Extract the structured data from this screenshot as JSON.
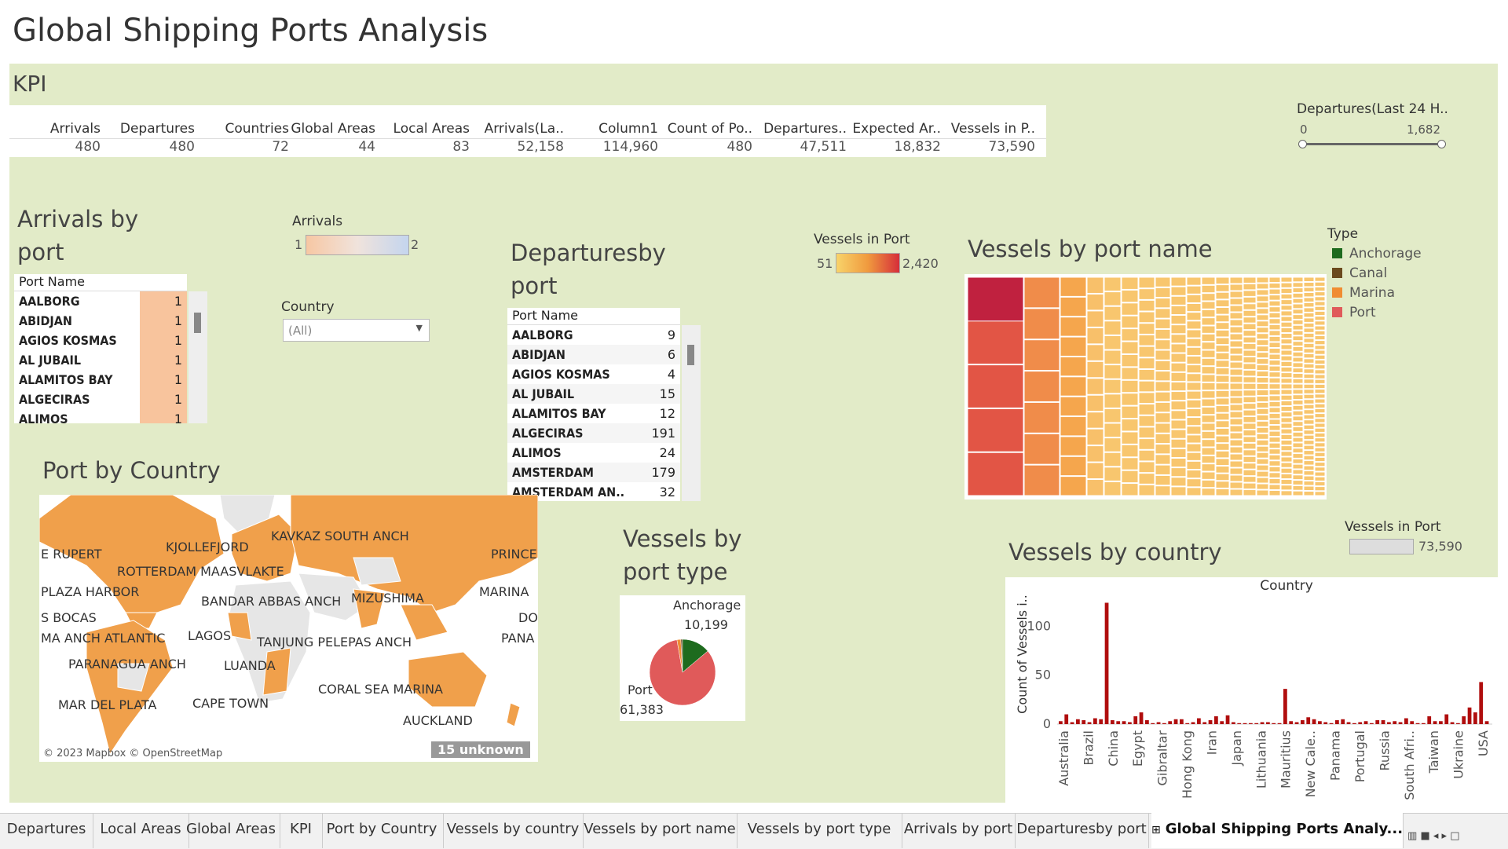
{
  "header": {
    "title": "Global Shipping Ports Analysis"
  },
  "kpi": {
    "title": "KPI",
    "columns": [
      {
        "label": "Arrivals",
        "value": "480"
      },
      {
        "label": "Departures",
        "value": "480"
      },
      {
        "label": "Countries",
        "value": "72"
      },
      {
        "label": "Global Areas",
        "value": "44"
      },
      {
        "label": "Local Areas",
        "value": "83"
      },
      {
        "label": "Arrivals(La..",
        "value": "52,158"
      },
      {
        "label": "Column1",
        "value": "114,960"
      },
      {
        "label": "Count of Po..",
        "value": "480"
      },
      {
        "label": "Departures..",
        "value": "47,511"
      },
      {
        "label": "Expected Ar..",
        "value": "18,832"
      },
      {
        "label": "Vessels in P..",
        "value": "73,590"
      }
    ]
  },
  "departures_filter": {
    "title": "Departures(Last 24 H..",
    "min": "0",
    "max": "1,682"
  },
  "arrivals_by_port": {
    "title_line1": "Arrivals by",
    "title_line2": "port",
    "column_header": "Port Name",
    "rows": [
      {
        "name": "AALBORG",
        "value": "1"
      },
      {
        "name": "ABIDJAN",
        "value": "1"
      },
      {
        "name": "AGIOS KOSMAS",
        "value": "1"
      },
      {
        "name": "AL JUBAIL",
        "value": "1"
      },
      {
        "name": "ALAMITOS BAY",
        "value": "1"
      },
      {
        "name": "ALGECIRAS",
        "value": "1"
      },
      {
        "name": "ALIMOS",
        "value": "1"
      }
    ],
    "legend_title": "Arrivals",
    "legend_min": "1",
    "legend_max": "2"
  },
  "country_filter": {
    "label": "Country",
    "selected": "(All)"
  },
  "departures_by_port": {
    "title_line1": "Departuresby",
    "title_line2": "port",
    "column_header": "Port Name",
    "rows": [
      {
        "name": "AALBORG",
        "value": "9"
      },
      {
        "name": "ABIDJAN",
        "value": "6"
      },
      {
        "name": "AGIOS KOSMAS",
        "value": "4"
      },
      {
        "name": "AL JUBAIL",
        "value": "15"
      },
      {
        "name": "ALAMITOS BAY",
        "value": "12"
      },
      {
        "name": "ALGECIRAS",
        "value": "191"
      },
      {
        "name": "ALIMOS",
        "value": "24"
      },
      {
        "name": "AMSTERDAM",
        "value": "179"
      },
      {
        "name": "AMSTERDAM AN..",
        "value": "32"
      }
    ]
  },
  "vessels_legend": {
    "title": "Vessels in Port",
    "min": "51",
    "max": "2,420"
  },
  "vessels_by_port_name": {
    "title": "Vessels by port name"
  },
  "type_legend": {
    "title": "Type",
    "items": [
      {
        "label": "Anchorage",
        "color": "#1e6b1e"
      },
      {
        "label": "Canal",
        "color": "#6b4a1e"
      },
      {
        "label": "Marina",
        "color": "#f08c32"
      },
      {
        "label": "Port",
        "color": "#e05a5a"
      }
    ]
  },
  "port_by_country": {
    "title": "Port by Country",
    "labels": [
      "E RUPERT",
      "KJOLLEFJORD",
      "KAVKAZ SOUTH ANCH",
      "PRINCE",
      "ROTTERDAM MAASVLAKTE",
      "PLAZA HARBOR",
      "BANDAR ABBAS ANCH",
      "MIZUSHIMA",
      "MARINA",
      "S BOCAS",
      "DO",
      "MA ANCH ATLANTIC",
      "LAGOS",
      "TANJUNG PELEPAS ANCH",
      "PANA",
      "PARANAGUA ANCH",
      "LUANDA",
      "CORAL SEA MARINA",
      "MAR DEL PLATA",
      "CAPE TOWN",
      "AUCKLAND"
    ],
    "attribution": "© 2023 Mapbox © OpenStreetMap",
    "unknown_badge": "15 unknown"
  },
  "vessels_by_port_type": {
    "title_line1": "Vessels by",
    "title_line2": "port type",
    "anchorage_label": "Anchorage",
    "anchorage_value": "10,199",
    "port_label": "Port",
    "port_value": "61,383",
    "slices": [
      {
        "type": "Port",
        "value": 61383,
        "color": "#e05a5a"
      },
      {
        "type": "Marina",
        "value": 1400,
        "color": "#f08c32"
      },
      {
        "type": "Canal",
        "value": 600,
        "color": "#6b4a1e"
      },
      {
        "type": "Anchorage",
        "value": 10199,
        "color": "#1e6b1e"
      }
    ]
  },
  "vessels_legend2": {
    "title": "Vessels in Port",
    "value": "73,590"
  },
  "chart_data": {
    "type": "bar",
    "title": "Vessels by country",
    "xlabel": "Country",
    "ylabel": "Count of Vessels i..",
    "yticks": [
      0,
      50,
      100
    ],
    "ylim": [
      0,
      130
    ],
    "tick_labels": [
      "Australia",
      "Brazil",
      "China",
      "Egypt",
      "Gibraltar",
      "Hong Kong",
      "Iran",
      "Japan",
      "Lithuania",
      "Mauritius",
      "New Cale..",
      "Panama",
      "Portugal",
      "Russia",
      "South Afri..",
      "Taiwan",
      "Ukraine",
      "USA"
    ],
    "values": [
      3,
      10,
      2,
      5,
      4,
      2,
      6,
      5,
      124,
      4,
      3,
      3,
      2,
      8,
      12,
      4,
      1,
      2,
      1,
      3,
      5,
      5,
      1,
      2,
      6,
      2,
      4,
      8,
      3,
      9,
      2,
      1,
      1,
      1,
      1,
      2,
      2,
      1,
      1,
      36,
      3,
      2,
      4,
      7,
      5,
      3,
      2,
      1,
      4,
      5,
      2,
      1,
      2,
      3,
      1,
      4,
      4,
      2,
      3,
      2,
      6,
      3,
      1,
      1,
      8,
      3,
      3,
      10,
      2,
      1,
      8,
      17,
      12,
      43,
      3
    ]
  },
  "tabs": [
    {
      "label": "Departures"
    },
    {
      "label": "Local Areas"
    },
    {
      "label": "Global Areas"
    },
    {
      "label": "KPI"
    },
    {
      "label": "Port by Country"
    },
    {
      "label": "Vessels by country"
    },
    {
      "label": "Vessels by port name"
    },
    {
      "label": "Vessels by port type"
    },
    {
      "label": "Arrivals by port"
    },
    {
      "label": "Departuresby port"
    },
    {
      "label": "Global Shipping Ports Analy..."
    }
  ]
}
